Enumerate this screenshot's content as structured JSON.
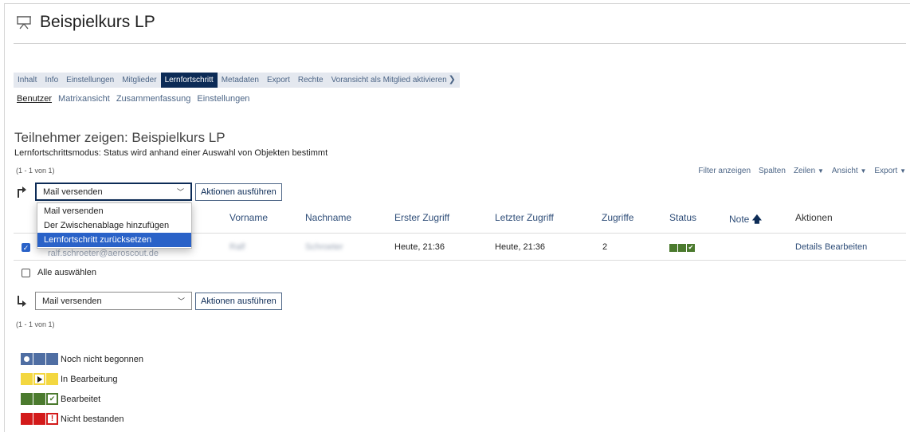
{
  "header": {
    "title": "Beispielkurs LP"
  },
  "tabs": [
    {
      "label": "Inhalt"
    },
    {
      "label": "Info"
    },
    {
      "label": "Einstellungen"
    },
    {
      "label": "Mitglieder"
    },
    {
      "label": "Lernfortschritt"
    },
    {
      "label": "Metadaten"
    },
    {
      "label": "Export"
    },
    {
      "label": "Rechte"
    },
    {
      "label": "Voransicht als Mitglied aktivieren"
    }
  ],
  "subtabs": [
    {
      "label": "Benutzer"
    },
    {
      "label": "Matrixansicht"
    },
    {
      "label": "Zusammenfassung"
    },
    {
      "label": "Einstellungen"
    }
  ],
  "section": {
    "title": "Teilnehmer zeigen: Beispielkurs LP",
    "subtitle": "Lernfortschrittsmodus: Status wird anhand einer Auswahl von Objekten bestimmt",
    "range": "(1 - 1 von 1)"
  },
  "toolbar": {
    "filter": "Filter anzeigen",
    "columns": "Spalten",
    "rows": "Zeilen",
    "view": "Ansicht",
    "export": "Export"
  },
  "actions": {
    "select_value": "Mail versenden",
    "execute_label": "Aktionen ausführen",
    "options": [
      "Mail versenden",
      "Der Zwischenablage hinzufügen",
      "Lernfortschritt zurücksetzen"
    ],
    "selected_option_index": 2
  },
  "table": {
    "columns": [
      "Vorname",
      "Nachname",
      "Erster Zugriff",
      "Letzter Zugriff",
      "Zugriffe",
      "Status",
      "Note",
      "Aktionen"
    ],
    "sorted_column": "Note",
    "row": {
      "login": "ralf.schroeter@aeroscout.de",
      "vorname": "Ralf",
      "nachname": "Schroeter",
      "erster_zugriff": "Heute, 21:36",
      "letzter_zugriff": "Heute, 21:36",
      "zugriffe": "2",
      "status": "Bearbeitet",
      "action_details": "Details",
      "action_edit": "Bearbeiten",
      "checked": true
    },
    "select_all": "Alle auswählen"
  },
  "legend": [
    {
      "label": "Noch nicht begonnen",
      "color": "#4f6ea3"
    },
    {
      "label": "In Bearbeitung",
      "color": "#f3d740"
    },
    {
      "label": "Bearbeitet",
      "color": "#4b7a2e"
    },
    {
      "label": "Nicht bestanden",
      "color": "#d31a1a"
    }
  ],
  "icons": {
    "header": "presentation-board-icon",
    "action_top": "arrow-turn-up-right-icon",
    "action_bottom": "arrow-turn-down-right-icon",
    "sort": "arrow-up-icon"
  }
}
